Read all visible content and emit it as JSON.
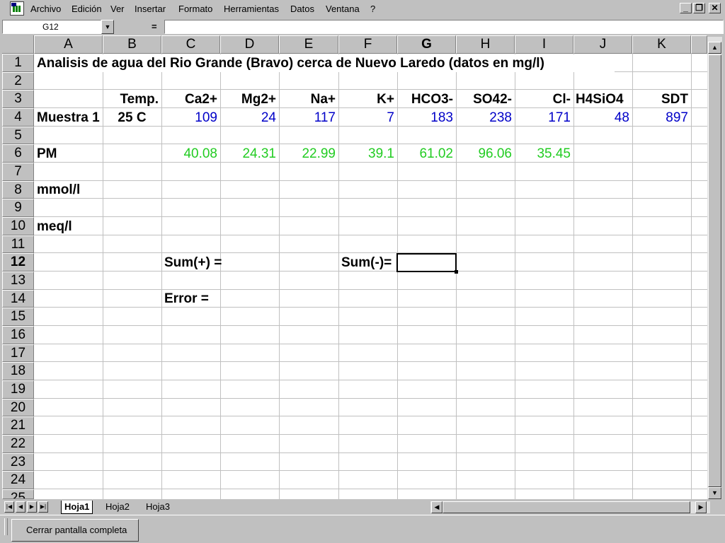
{
  "menu": {
    "items": [
      "Archivo",
      "Edición",
      "Ver",
      "Insertar",
      "Formato",
      "Herramientas",
      "Datos",
      "Ventana",
      "?"
    ]
  },
  "window_controls": {
    "minimize": "_",
    "restore": "❐",
    "close": "✕"
  },
  "formula_bar": {
    "name_box": "G12",
    "equals": "=",
    "formula": ""
  },
  "columns": [
    "A",
    "B",
    "C",
    "D",
    "E",
    "F",
    "G",
    "H",
    "I",
    "J",
    "K"
  ],
  "active_column": "G",
  "rows": [
    "1",
    "2",
    "3",
    "4",
    "5",
    "6",
    "7",
    "8",
    "9",
    "10",
    "11",
    "12",
    "13",
    "14",
    "15",
    "16",
    "17",
    "18",
    "19",
    "20",
    "21",
    "22",
    "23",
    "24",
    "25"
  ],
  "active_row": "12",
  "sheet": {
    "title": "Analisis de agua del Rio Grande (Bravo) cerca de Nuevo Laredo (datos en mg/l)",
    "headers": [
      "Temp.",
      "Ca2+",
      "Mg2+",
      "Na+",
      "K+",
      "HCO3-",
      "SO42-",
      "Cl-",
      "H4SiO4",
      "SDT"
    ],
    "sample_label": "Muestra 1",
    "sample_temp": "25 C",
    "sample_values": [
      "109",
      "24",
      "117",
      "7",
      "183",
      "238",
      "171",
      "48",
      "897"
    ],
    "pm_label": "PM",
    "pm_values": [
      "40.08",
      "24.31",
      "22.99",
      "39.1",
      "61.02",
      "96.06",
      "35.45"
    ],
    "mmol_label": "mmol/l",
    "meq_label": "meq/l",
    "sum_pos": "Sum(+) =",
    "sum_neg": "Sum(-)=",
    "error": "Error ="
  },
  "colors": {
    "numbers": "#0000c8",
    "pm_values": "#22cc22",
    "grid": "#c0c0c0",
    "chrome": "#c0c0c0"
  },
  "tabs": [
    "Hoja1",
    "Hoja2",
    "Hoja3"
  ],
  "active_tab": "Hoja1",
  "taskbar": {
    "button_label": "Cerrar pantalla completa"
  }
}
